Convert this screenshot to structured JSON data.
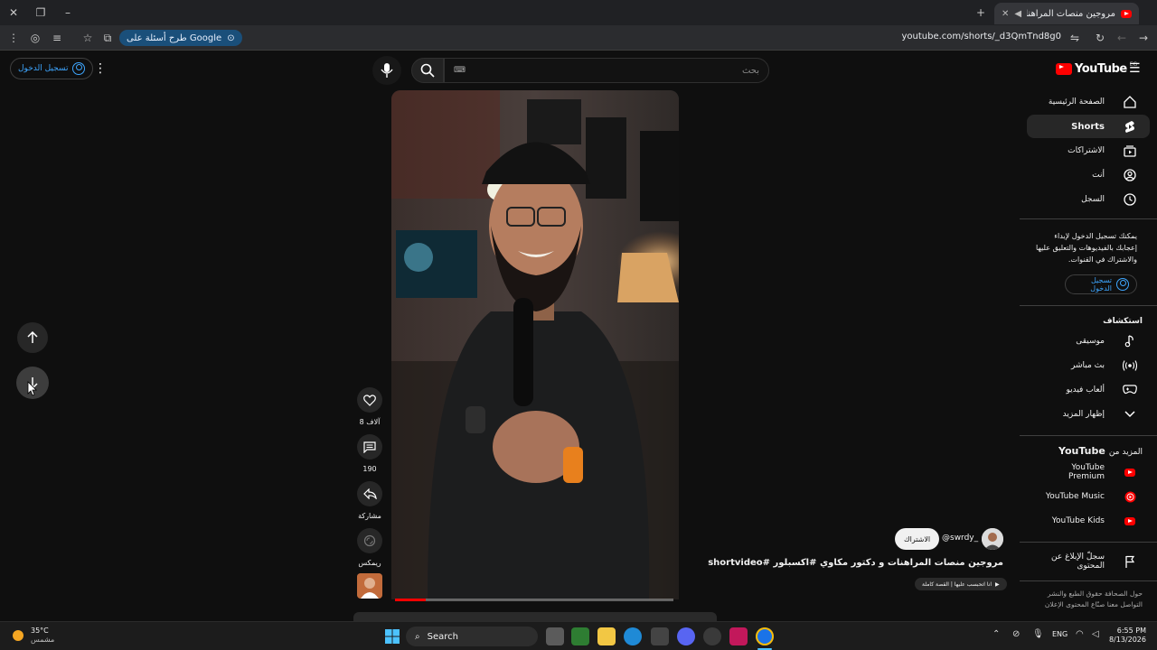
{
  "browser": {
    "tab_title": "مروجين منصات المراهنات و",
    "url": "youtube.com/shorts/_d3QmTnd8g0",
    "google_pill": "طرح أسئلة على Google"
  },
  "header": {
    "logo_text": "YouTube",
    "region_code": "EG",
    "search_placeholder": "بحث",
    "signin_label": "تسجيل الدخول"
  },
  "sidebar": {
    "items": [
      {
        "label": "الصفحة الرئيسية",
        "icon": "home-icon"
      },
      {
        "label": "Shorts",
        "icon": "shorts-icon",
        "active": true
      },
      {
        "label": "الاشتراكات",
        "icon": "subscriptions-icon"
      },
      {
        "label": "أنت",
        "icon": "you-icon"
      },
      {
        "label": "السجل",
        "icon": "history-icon"
      }
    ],
    "signin_prompt": "يمكنك تسجيل الدخول لإبداء إعجابك بالفيديوهات والتعليق عليها والاشتراك في القنوات.",
    "signin_label": "تسجيل الدخول",
    "explore_title": "استكشاف",
    "explore": [
      {
        "label": "موسيقى",
        "icon": "music-icon"
      },
      {
        "label": "بث مباشر",
        "icon": "live-icon"
      },
      {
        "label": "ألعاب فيديو",
        "icon": "gaming-icon"
      },
      {
        "label": "إظهار المزيد",
        "icon": "chevron-down-icon"
      }
    ],
    "more_from_prefix": "المزيد من",
    "more_from_brand": "YouTube",
    "more": [
      {
        "label": "YouTube Premium"
      },
      {
        "label": "YouTube Music"
      },
      {
        "label": "YouTube Kids"
      }
    ],
    "report_label": "سجلّ الإبلاغ عن المحتوى",
    "footer_line1": "حول  الصحافة  حقوق الطبع والنشر",
    "footer_line2": "التواصل معنا  صنّاع المحتوى  الإعلان"
  },
  "short": {
    "channel": "@swrdy_",
    "subscribe_label": "الاشتراك",
    "title": "مروجين منصات المراهنات و دكتور مكاوي #اكسبلور #shortvideo",
    "audio": "انا اتحبسب عليها | القصة كاملة",
    "progress": 0.11
  },
  "actions": {
    "likes": "8 آلاف",
    "comments": "190",
    "share": "مشاركة",
    "remix": "ريمكس"
  },
  "taskbar": {
    "temp": "35°C",
    "weather": "مشمس",
    "search": "Search",
    "lang": "ENG",
    "time": "6:55 PM",
    "date": "8/13/2026"
  },
  "colors": {
    "accent": "#3ea6ff",
    "brand": "#ff0000",
    "bg": "#0f0f0f"
  }
}
